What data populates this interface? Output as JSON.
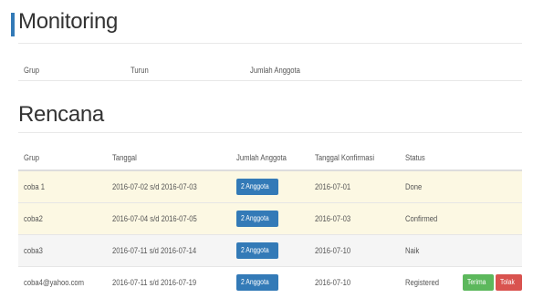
{
  "monitoring": {
    "title": "Monitoring",
    "columns": [
      "Grup",
      "Turun",
      "Jumlah Anggota"
    ]
  },
  "rencana": {
    "title": "Rencana",
    "columns": [
      "Grup",
      "Tanggal",
      "Jumlah Anggota",
      "Tanggal Konfirmasi",
      "Status"
    ],
    "rows": [
      {
        "grup": "coba 1",
        "tanggal": "2016-07-02 s/d 2016-07-03",
        "anggota": "2 Anggota",
        "konfirmasi": "2016-07-01",
        "status": "Done"
      },
      {
        "grup": "coba2",
        "tanggal": "2016-07-04 s/d 2016-07-05",
        "anggota": "2 Anggota",
        "konfirmasi": "2016-07-03",
        "status": "Confirmed"
      },
      {
        "grup": "coba3",
        "tanggal": "2016-07-11 s/d 2016-07-14",
        "anggota": "2 Anggota",
        "konfirmasi": "2016-07-10",
        "status": "Naik"
      },
      {
        "grup": "coba4@yahoo.com",
        "tanggal": "2016-07-11 s/d 2016-07-19",
        "anggota": "2 Anggota",
        "konfirmasi": "2016-07-10",
        "status": "Registered"
      }
    ],
    "actions": {
      "accept": "Terima",
      "reject": "Tolak"
    }
  },
  "colors": {
    "accent": "#337ab7",
    "warning_row": "#fcf8e3",
    "success": "#5cb85c",
    "danger": "#d9534f"
  }
}
